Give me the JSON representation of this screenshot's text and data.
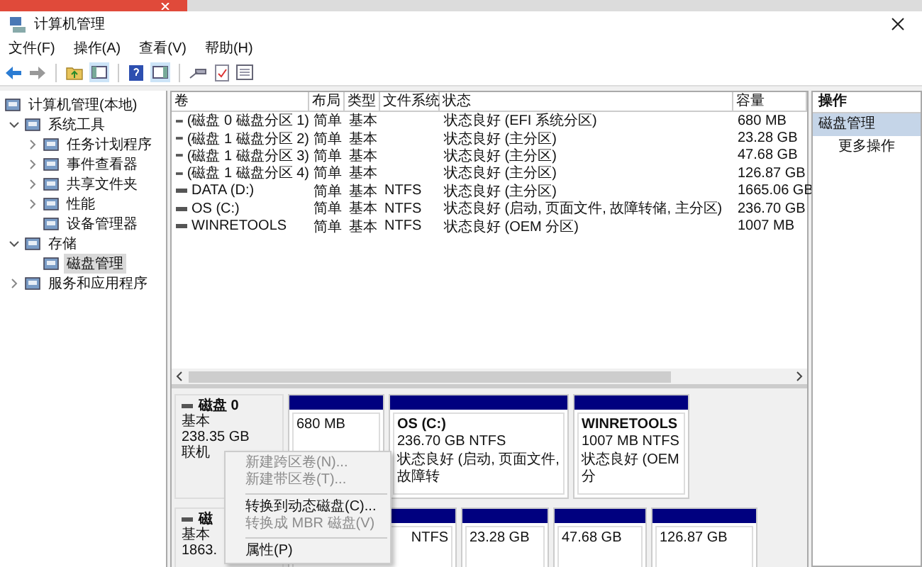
{
  "window": {
    "title": "计算机管理"
  },
  "menu": [
    "文件(F)",
    "操作(A)",
    "查看(V)",
    "帮助(H)"
  ],
  "tree": [
    {
      "label": "计算机管理(本地)",
      "selected": false,
      "children": [
        {
          "label": "系统工具",
          "expandable": true,
          "expanded": true,
          "selected": false,
          "children": [
            {
              "label": "任务计划程序",
              "expandable": true,
              "expanded": false,
              "selected": false
            },
            {
              "label": "事件查看器",
              "expandable": true,
              "expanded": false,
              "selected": false
            },
            {
              "label": "共享文件夹",
              "expandable": true,
              "expanded": false,
              "selected": false
            },
            {
              "label": "性能",
              "expandable": true,
              "expanded": false,
              "selected": false
            },
            {
              "label": "设备管理器",
              "expandable": false,
              "expanded": false,
              "selected": false
            }
          ]
        },
        {
          "label": "存储",
          "expandable": true,
          "expanded": true,
          "selected": false,
          "children": [
            {
              "label": "磁盘管理",
              "expandable": false,
              "expanded": false,
              "selected": true
            }
          ]
        },
        {
          "label": "服务和应用程序",
          "expandable": true,
          "expanded": false,
          "selected": false
        }
      ]
    }
  ],
  "table": {
    "columns": [
      "卷",
      "布局",
      "类型",
      "文件系统",
      "状态",
      "容量"
    ],
    "rows": [
      [
        "(磁盘 0 磁盘分区 1)",
        "简单",
        "基本",
        "",
        "状态良好 (EFI 系统分区)",
        "680 MB"
      ],
      [
        "(磁盘 1 磁盘分区 2)",
        "简单",
        "基本",
        "",
        "状态良好 (主分区)",
        "23.28 GB"
      ],
      [
        "(磁盘 1 磁盘分区 3)",
        "简单",
        "基本",
        "",
        "状态良好 (主分区)",
        "47.68 GB"
      ],
      [
        "(磁盘 1 磁盘分区 4)",
        "简单",
        "基本",
        "",
        "状态良好 (主分区)",
        "126.87 GB"
      ],
      [
        "DATA (D:)",
        "简单",
        "基本",
        "NTFS",
        "状态良好 (主分区)",
        "1665.06 GB"
      ],
      [
        "OS (C:)",
        "简单",
        "基本",
        "NTFS",
        "状态良好 (启动, 页面文件, 故障转储, 主分区)",
        "236.70 GB"
      ],
      [
        "WINRETOOLS",
        "简单",
        "基本",
        "NTFS",
        "状态良好 (OEM 分区)",
        "1007 MB"
      ]
    ]
  },
  "disks": [
    {
      "name": "磁盘 0",
      "lines": [
        "基本",
        "238.35 GB",
        "联机"
      ],
      "partitions": [
        {
          "kind": "normal",
          "lines": [
            "680 MB"
          ]
        },
        {
          "kind": "normal",
          "title": "OS  (C:)",
          "lines": [
            "236.70 GB NTFS",
            "状态良好 (启动, 页面文件, 故障转"
          ]
        },
        {
          "kind": "normal",
          "title": "WINRETOOLS",
          "lines": [
            "1007 MB NTFS",
            "状态良好 (OEM 分"
          ]
        }
      ]
    },
    {
      "name": "磁",
      "lines": [
        "基本",
        "1863."
      ],
      "partitions": [
        {
          "kind": "covered",
          "lines": [
            "NTFS"
          ]
        },
        {
          "kind": "normal",
          "lines": [
            "23.28 GB"
          ]
        },
        {
          "kind": "normal",
          "lines": [
            "47.68 GB"
          ]
        },
        {
          "kind": "normal",
          "lines": [
            "126.87 GB"
          ]
        }
      ]
    }
  ],
  "actions": {
    "header": "操作",
    "items": [
      {
        "label": "磁盘管理",
        "selected": true
      },
      {
        "label": "更多操作",
        "selected": false
      }
    ]
  },
  "context_menu": [
    {
      "kind": "item",
      "label": "新建跨区卷(N)...",
      "disabled": true
    },
    {
      "kind": "item",
      "label": "新建带区卷(T)...",
      "disabled": true
    },
    {
      "kind": "separator"
    },
    {
      "kind": "item",
      "label": "转换到动态磁盘(C)...",
      "disabled": false
    },
    {
      "kind": "item",
      "label": "转换成 MBR 磁盘(V)",
      "disabled": true
    },
    {
      "kind": "separator"
    },
    {
      "kind": "item",
      "label": "属性(P)",
      "disabled": false
    }
  ]
}
